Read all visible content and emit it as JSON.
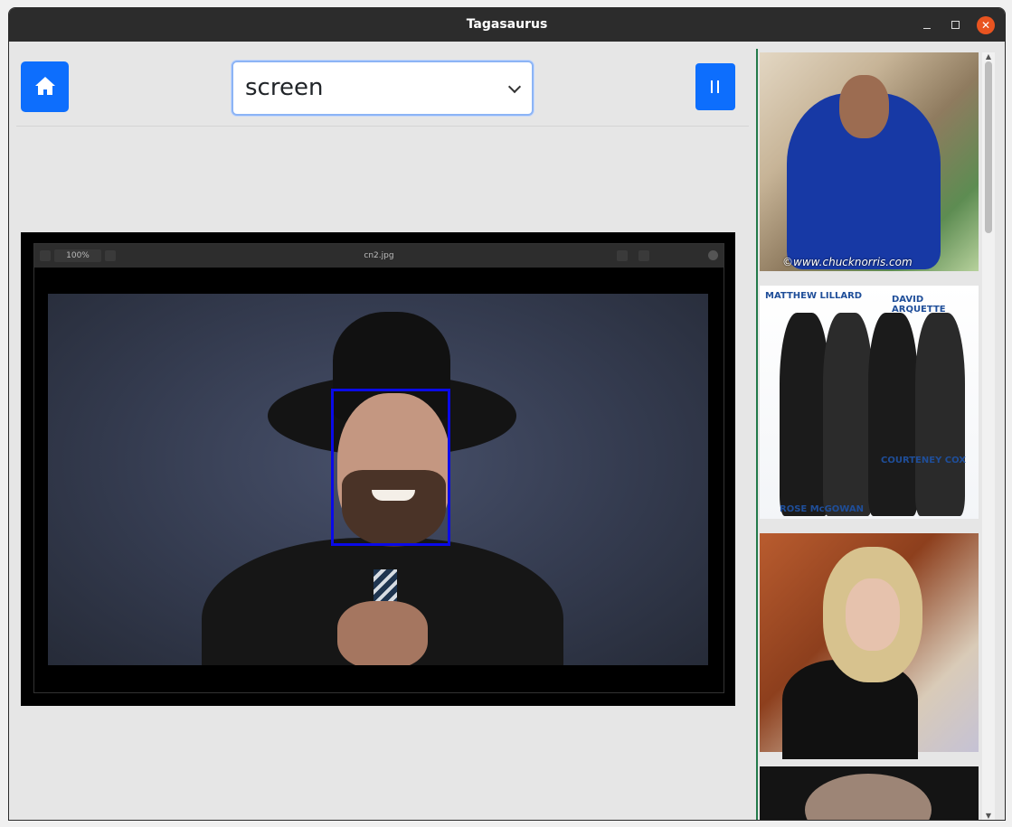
{
  "window": {
    "title": "Tagasaurus",
    "controls": {
      "close": "✕"
    }
  },
  "toolbar": {
    "source_select": {
      "value": "screen"
    }
  },
  "viewer": {
    "filename": "cn2.jpg",
    "zoom": "100%"
  },
  "gallery": {
    "items": [
      {
        "watermark": "©www.chucknorris.com"
      },
      {
        "labels": [
          "MATTHEW LILLARD",
          "DAVID ARQUETTE",
          "COURTENEY COX",
          "ROSE McGOWAN"
        ]
      },
      {},
      {}
    ]
  },
  "colors": {
    "accent": "#0d6efd",
    "face_box": "#0a0ae8",
    "divider": "#237a4a"
  }
}
